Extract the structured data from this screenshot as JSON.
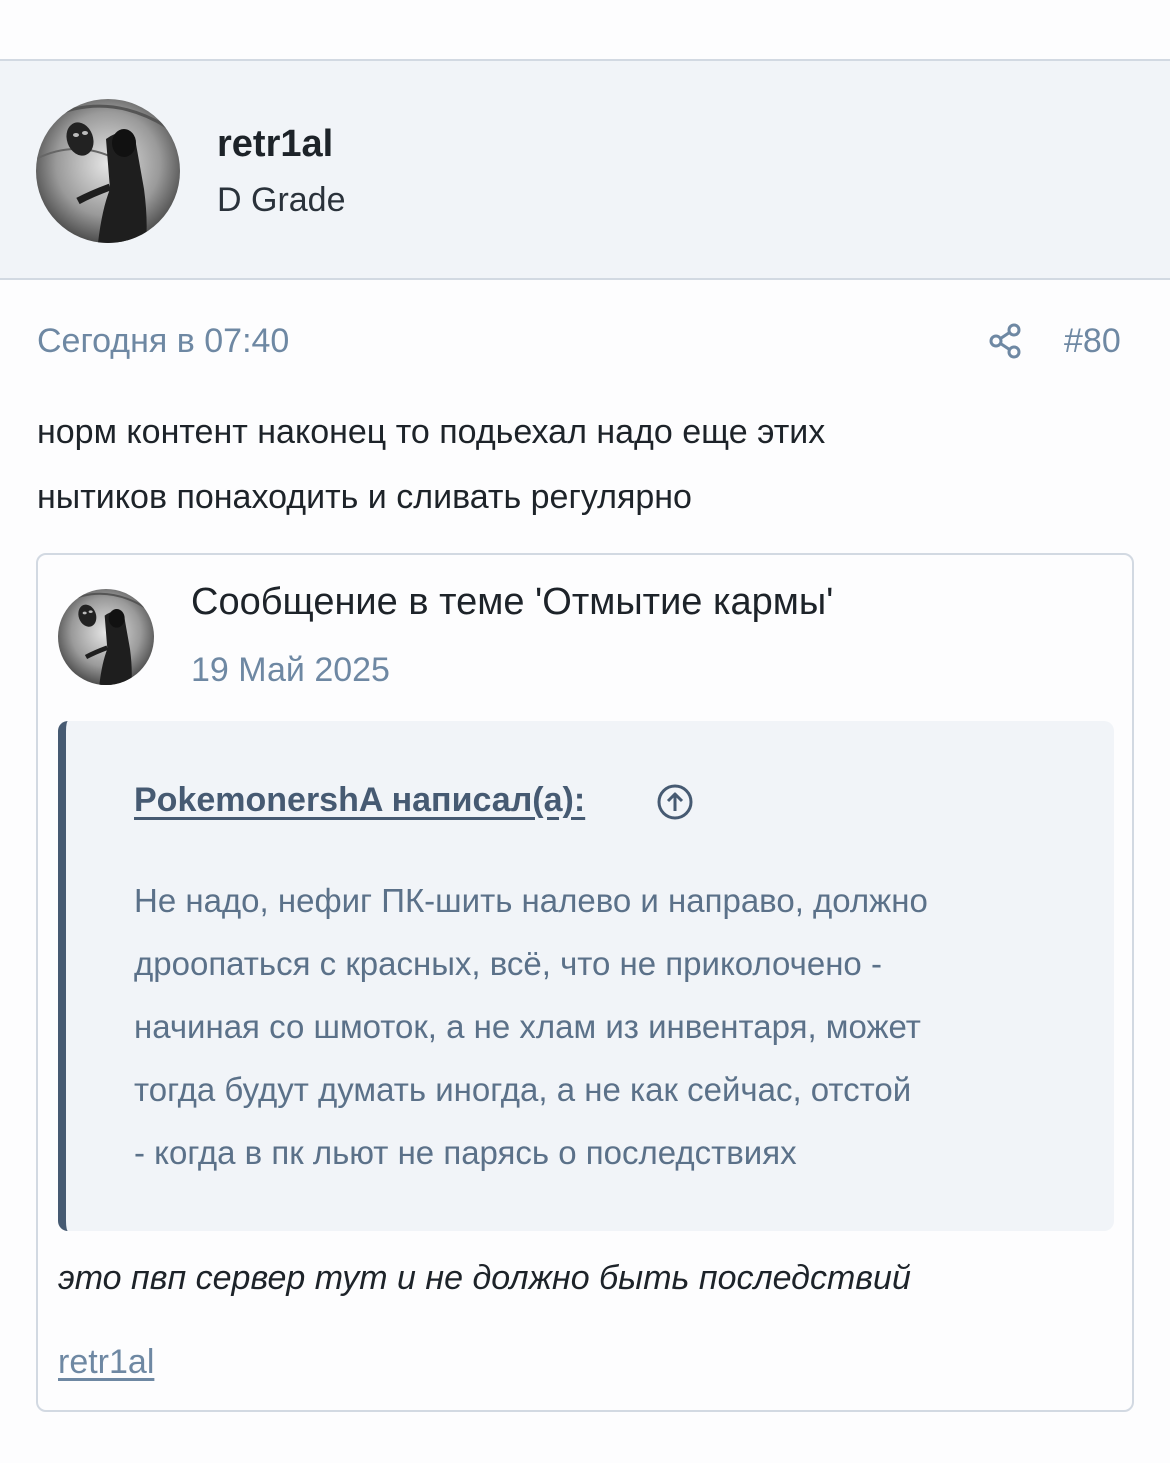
{
  "user": {
    "name": "retr1al",
    "title": "D Grade"
  },
  "post": {
    "date": "Сегодня в 07:40",
    "number": "#80",
    "share_icon": "share-icon",
    "text_line1": "норм контент наконец то подьехал надо еще этих",
    "text_line2": "нытиков понаходить и сливать регулярно"
  },
  "embed": {
    "title": "Сообщение в теме 'Отмытие кармы'",
    "date": "19 Май 2025",
    "quote_author": "PokemonershA написал(а):",
    "jump_icon": "arrow-up-circle-icon",
    "quote_lines": [
      "Не надо, нефиг ПК-шить налево и направо, должно",
      "дроопаться с красных, всё, что не приколочено -",
      "начиная со шмоток, а не хлам из инвентаря, может",
      "тогда будут думать иногда, а не как сейчас, отстой",
      "- когда в пк льют не парясь о последствиях"
    ],
    "reply": "это пвп сервер тут и не должно быть последствий",
    "author_link": "retr1al"
  },
  "colors": {
    "header_bg": "#f1f4f8",
    "muted_text": "#6e88a3",
    "quote_border": "#465a72",
    "quote_text": "#5b7189",
    "border": "#d2d9e2"
  }
}
